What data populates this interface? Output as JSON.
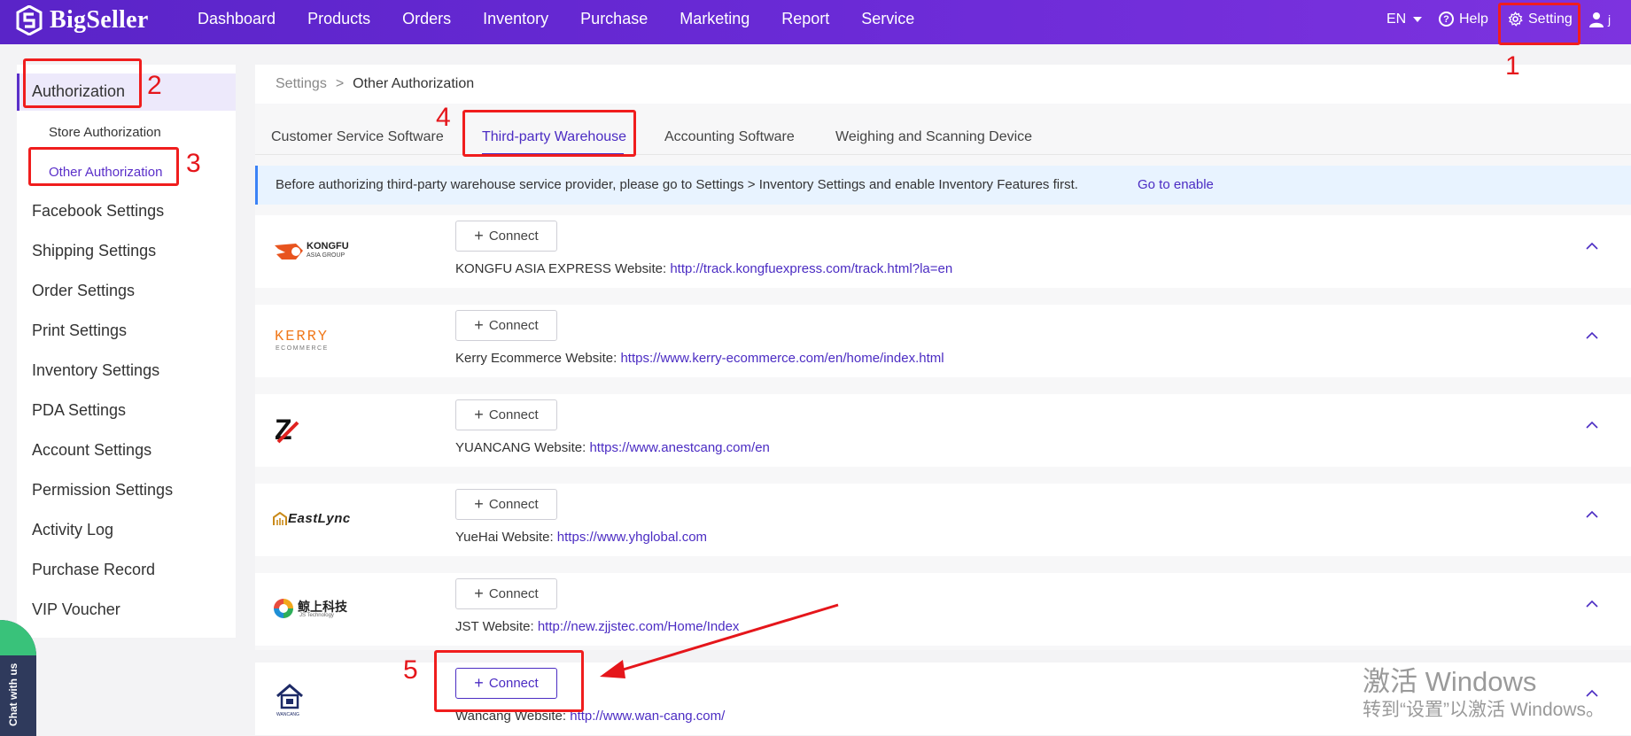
{
  "app": {
    "brand": "BigSeller",
    "colors": {
      "accent": "#4b2cc3",
      "nav_bg": "#6a2ad6",
      "annotation": "#f01d1d",
      "notice_bg": "#e8f3ff"
    }
  },
  "topnav": {
    "items": [
      "Dashboard",
      "Products",
      "Orders",
      "Inventory",
      "Purchase",
      "Marketing",
      "Report",
      "Service"
    ],
    "lang": "EN",
    "help": "Help",
    "setting": "Setting",
    "user_initial": "j"
  },
  "sidebar": {
    "section": "Authorization",
    "subitems": [
      "Store Authorization",
      "Other Authorization"
    ],
    "items": [
      "Facebook Settings",
      "Shipping Settings",
      "Order Settings",
      "Print Settings",
      "Inventory Settings",
      "PDA Settings",
      "Account Settings",
      "Permission Settings",
      "Activity Log",
      "Purchase Record",
      "VIP Voucher"
    ]
  },
  "breadcrumb": {
    "root": "Settings",
    "sep": ">",
    "current": "Other Authorization"
  },
  "tabs": [
    "Customer Service Software",
    "Third-party Warehouse",
    "Accounting Software",
    "Weighing and Scanning Device"
  ],
  "notice": {
    "text": "Before authorizing third-party warehouse service provider, please go to Settings > Inventory Settings and enable Inventory Features first.",
    "link": "Go to enable"
  },
  "connect_label": "Connect",
  "providers": [
    {
      "name": "KONGFU ASIA EXPRESS",
      "label": "KONGFU ASIA EXPRESS Website:",
      "url": "http://track.kongfuexpress.com/track.html?la=en",
      "logo_text": "KONGFU",
      "logo_sub": "ASIA GROUP"
    },
    {
      "name": "Kerry Ecommerce",
      "label": "Kerry Ecommerce Website:",
      "url": "https://www.kerry-ecommerce.com/en/home/index.html",
      "logo_text": "KERRY",
      "logo_sub": "ECOMMERCE"
    },
    {
      "name": "YUANCANG",
      "label": "YUANCANG Website:",
      "url": "https://www.anestcang.com/en",
      "logo_text": "Z",
      "logo_sub": ""
    },
    {
      "name": "YueHai",
      "label": "YueHai Website:",
      "url": "https://www.yhglobal.com",
      "logo_text": "EastLync",
      "logo_sub": ""
    },
    {
      "name": "JST",
      "label": "JST Website:",
      "url": "http://new.zjjstec.com/Home/Index",
      "logo_text": "鲸上科技",
      "logo_sub": "JS Technology"
    },
    {
      "name": "Wancang",
      "label": "Wancang Website:",
      "url": "http://www.wan-cang.com/",
      "logo_text": "WANCANG",
      "logo_sub": ""
    }
  ],
  "annotations": [
    "1",
    "2",
    "3",
    "4",
    "5"
  ],
  "watermark": {
    "line1": "激活 Windows",
    "line2": "转到“设置”以激活 Windows。"
  },
  "chat": "Chat with us"
}
